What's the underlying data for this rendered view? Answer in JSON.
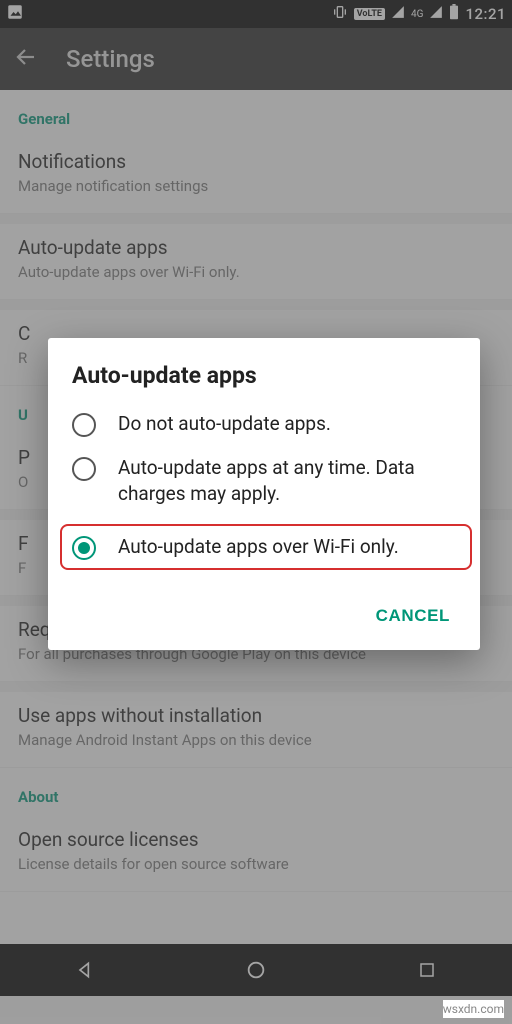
{
  "statusbar": {
    "clock": "12:21",
    "network_label": "4G",
    "volte": "VoLTE"
  },
  "appbar": {
    "title": "Settings"
  },
  "sections": {
    "general": {
      "header": "General",
      "notifications": {
        "title": "Notifications",
        "sub": "Manage notification settings"
      },
      "auto_update": {
        "title": "Auto-update apps",
        "sub": "Auto-update apps over Wi-Fi only."
      },
      "clear_local": {
        "title": "C",
        "sub": "R"
      }
    },
    "user": {
      "header": "U",
      "p": {
        "title": "P",
        "sub": "O"
      },
      "f": {
        "title": "F",
        "sub": "F"
      },
      "auth": {
        "title": "Require authentication for purchases",
        "sub": "For all purchases through Google Play on this device"
      },
      "instant": {
        "title": "Use apps without installation",
        "sub": "Manage Android Instant Apps on this device"
      }
    },
    "about": {
      "header": "About",
      "oss": {
        "title": "Open source licenses",
        "sub": "License details for open source software"
      }
    }
  },
  "dialog": {
    "title": "Auto-update apps",
    "options": [
      "Do not auto-update apps.",
      "Auto-update apps at any time. Data charges may apply.",
      "Auto-update apps over Wi-Fi only."
    ],
    "selected_index": 2,
    "cancel": "CANCEL"
  },
  "watermark": "wsxdn.com"
}
